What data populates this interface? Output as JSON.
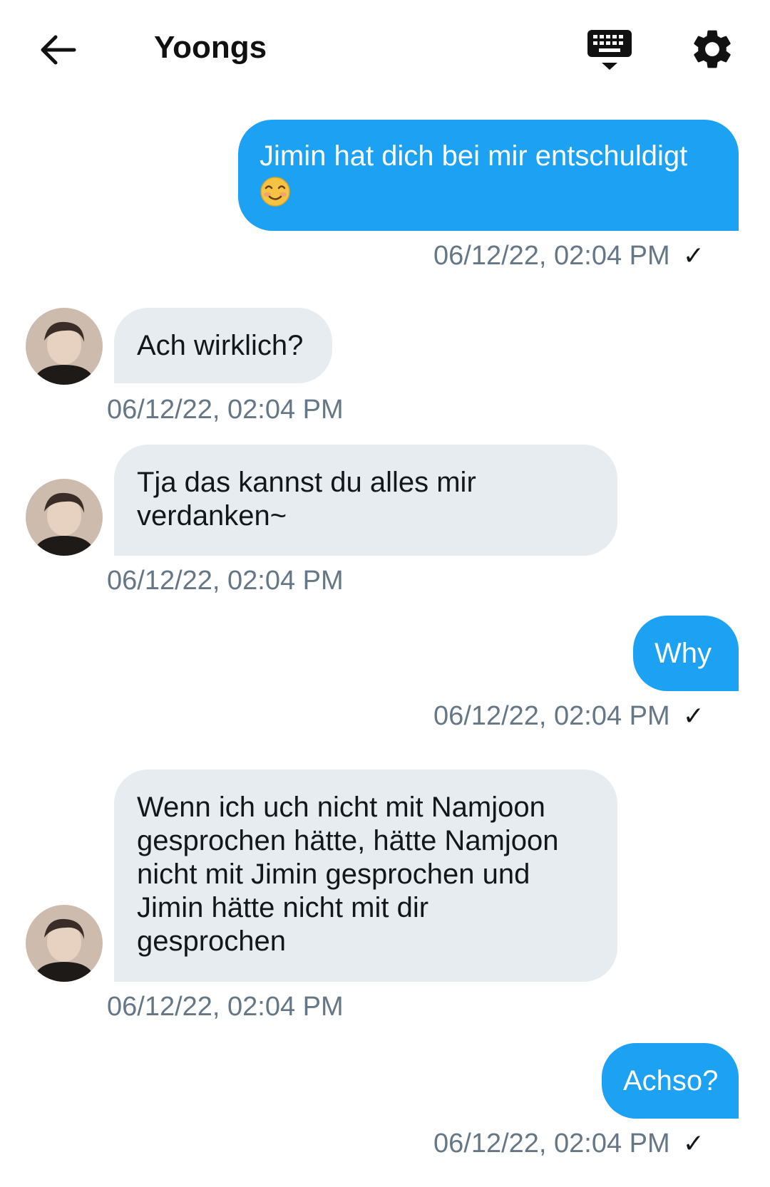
{
  "header": {
    "title": "Yoongs",
    "back_icon": "arrow-left-icon",
    "keyboard_icon": "keyboard-icon",
    "settings_icon": "gear-icon"
  },
  "colors": {
    "outgoing_bubble": "#1da1f2",
    "incoming_bubble": "#e6ecf0",
    "timestamp": "#657786"
  },
  "messages": [
    {
      "direction": "out",
      "text": "Jimin hat dich bei mir entschuldigt",
      "emoji": "smiling-face-icon",
      "time": "06/12/22, 02:04 PM",
      "read": "✓"
    },
    {
      "direction": "in",
      "text": "Ach wirklich?",
      "time": "06/12/22, 02:04 PM"
    },
    {
      "direction": "in",
      "text_lines": [
        "Tja das kannst du alles mir",
        "verdanken~"
      ],
      "time": "06/12/22, 02:04 PM"
    },
    {
      "direction": "out",
      "text": "Why",
      "time": "06/12/22, 02:04 PM",
      "read": "✓"
    },
    {
      "direction": "in",
      "text_lines": [
        "Wenn ich uch nicht mit Namjoon",
        "gesprochen hätte, hätte Namjoon",
        "nicht mit Jimin gesprochen und",
        "Jimin hätte nicht mit dir",
        "gesprochen"
      ],
      "time": "06/12/22, 02:04 PM"
    },
    {
      "direction": "out",
      "text": "Achso?",
      "time": "06/12/22, 02:04 PM",
      "read": "✓"
    }
  ]
}
